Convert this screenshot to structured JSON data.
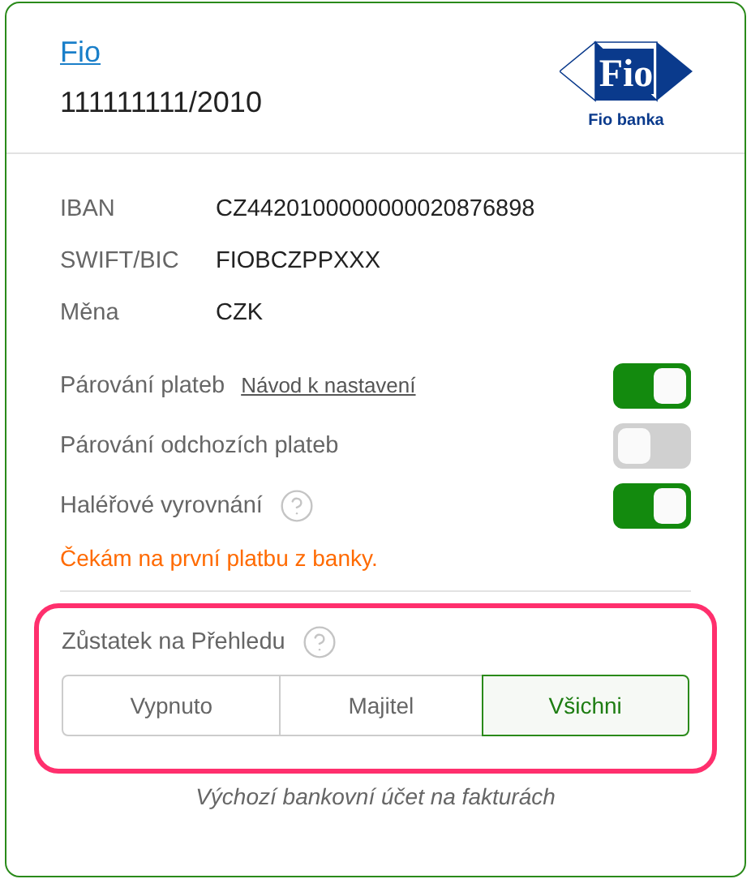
{
  "header": {
    "bank_link": "Fio",
    "account_number": "111111111/2010",
    "logo_mark": "Fio",
    "logo_caption": "Fio banka"
  },
  "details": [
    {
      "label": "IBAN",
      "value": "CZ4420100000000020876898"
    },
    {
      "label": "SWIFT/BIC",
      "value": "FIOBCZPPXXX"
    },
    {
      "label": "Měna",
      "value": "CZK"
    }
  ],
  "settings": [
    {
      "label": "Párování plateb",
      "link": "Návod k nastavení",
      "help": false,
      "on": true
    },
    {
      "label": "Párování odchozích plateb",
      "help": false,
      "on": false
    },
    {
      "label": "Haléřové vyrovnání",
      "help": true,
      "on": true
    }
  ],
  "warning": "Čekám na první platbu z banky.",
  "balance": {
    "title": "Zůstatek na Přehledu",
    "help": true,
    "options": [
      {
        "label": "Vypnuto",
        "selected": false
      },
      {
        "label": "Majitel",
        "selected": false
      },
      {
        "label": "Všichni",
        "selected": true
      }
    ]
  },
  "footer_note": "Výchozí bankovní účet na fakturách"
}
